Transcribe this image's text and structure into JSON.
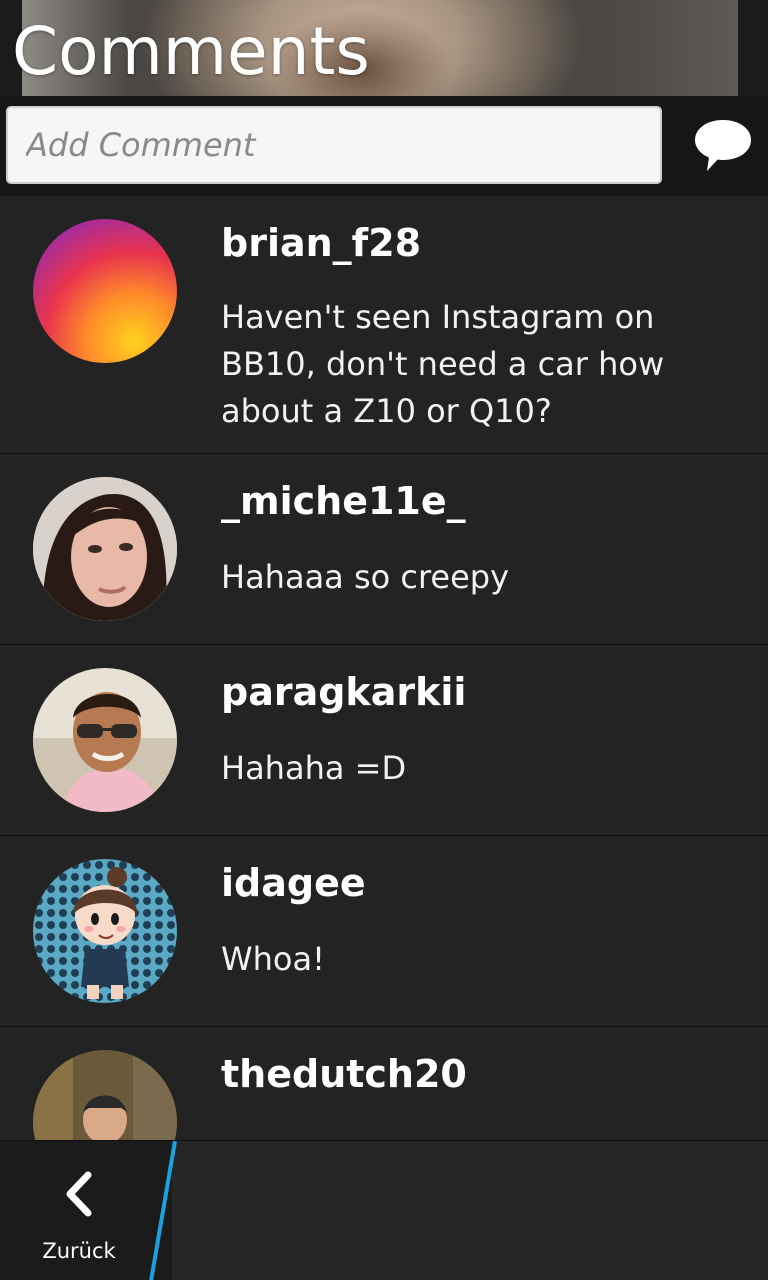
{
  "header": {
    "title": "Comments"
  },
  "compose": {
    "placeholder": "Add Comment",
    "send_icon": "speech-bubble-icon"
  },
  "comments": [
    {
      "username": "brian_f28",
      "text": "Haven't seen Instagram on BB10, don't need a car how about a Z10 or Q10?",
      "avatar": "gradient-avatar"
    },
    {
      "username": "_miche11e_",
      "text": "Hahaaa so creepy",
      "avatar": "photo-avatar"
    },
    {
      "username": "paragkarkii",
      "text": "Hahaha =D",
      "avatar": "photo-avatar"
    },
    {
      "username": "idagee",
      "text": "Whoa!",
      "avatar": "cartoon-avatar"
    },
    {
      "username": "thedutch20",
      "text": "",
      "avatar": "photo-avatar"
    }
  ],
  "action_bar": {
    "back_label": "Zurück",
    "back_icon": "chevron-left-icon",
    "accent_color": "#1ba1e2"
  }
}
